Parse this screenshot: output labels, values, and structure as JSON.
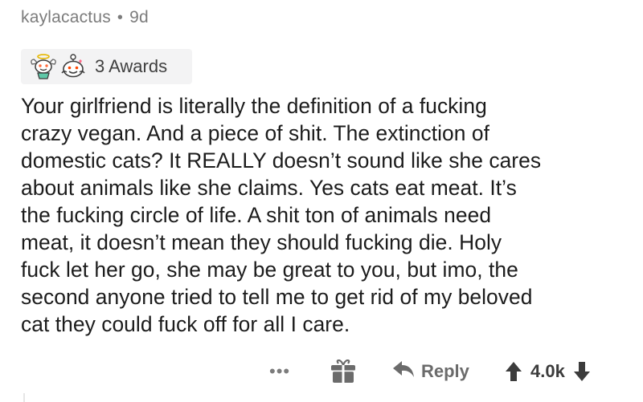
{
  "comment": {
    "author": "kaylacactus",
    "separator": "•",
    "age": "9d",
    "awards_label": "3 Awards",
    "body_lines": [
      "Your girlfriend is literally the definition of a fucking",
      "crazy vegan. And a piece of shit. The extinction of",
      "domestic cats? It REALLY doesn’t sound like she cares",
      "about animals like she claims. Yes cats eat meat. It’s",
      "the fucking circle of life. A shit ton of animals need",
      "meat, it doesn’t mean they should fucking die. Holy",
      "fuck let her go, she may be great to you, but imo, the",
      "second anyone tried to tell me to get rid of my beloved",
      "cat they could fuck off for all I care."
    ]
  },
  "actions": {
    "more_label": "•••",
    "reply_label": "Reply",
    "score": "4.0k"
  },
  "icons": {
    "award_1": "angel-award-icon",
    "award_2": "wholesome-award-icon",
    "gift": "gift-icon",
    "reply": "reply-arrow-icon",
    "upvote": "upvote-arrow-icon",
    "downvote": "downvote-arrow-icon"
  },
  "colors": {
    "meta_text": "#7c7c7c",
    "body_text": "#1c1c1c",
    "awards_bg": "#f3f3f4",
    "action_text": "#6b6b6b"
  }
}
